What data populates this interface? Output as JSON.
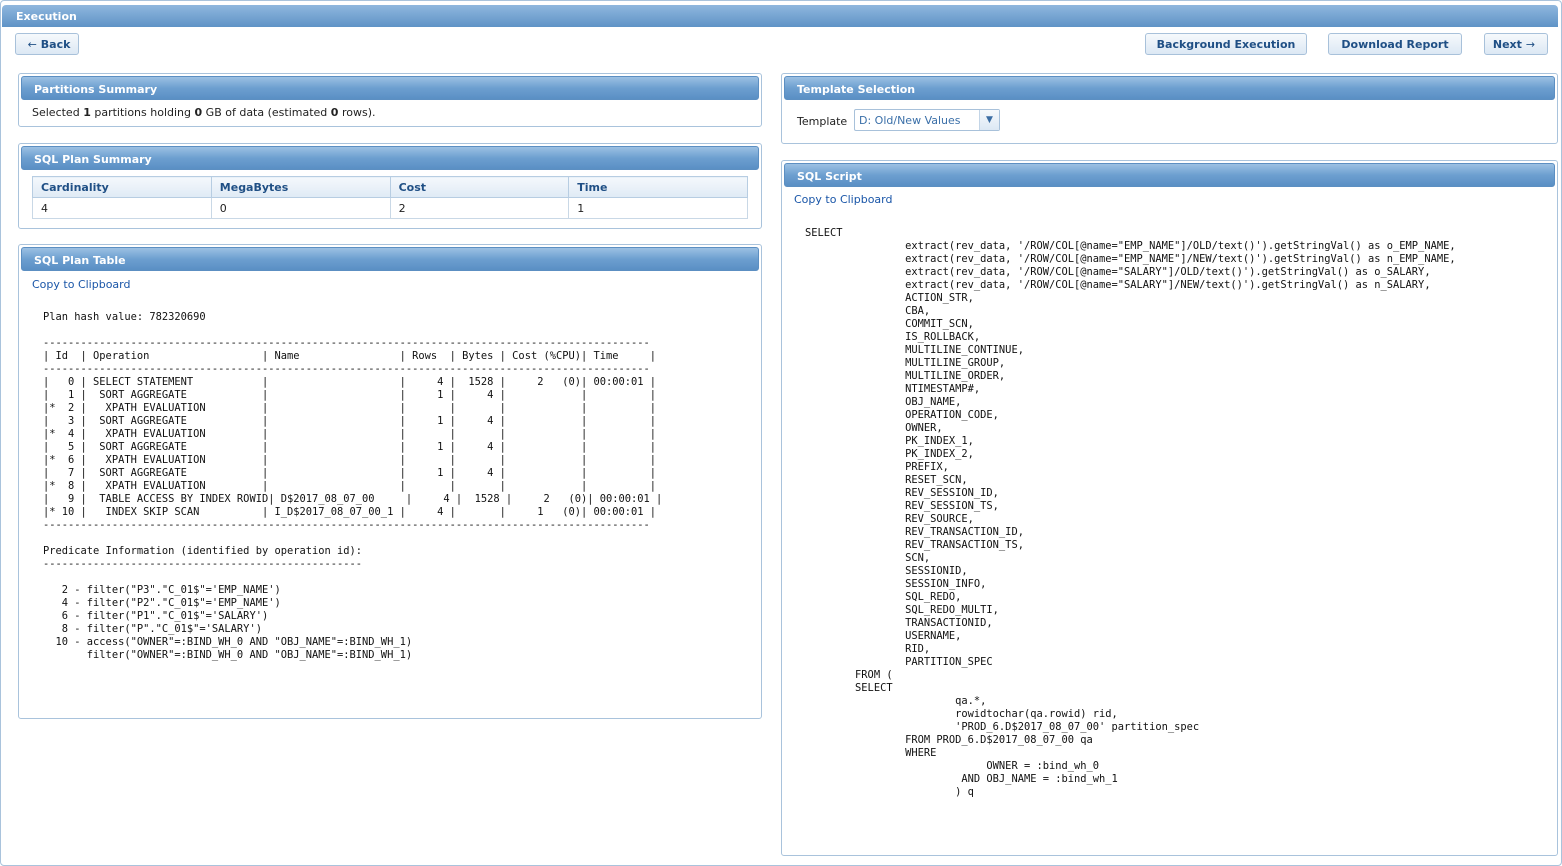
{
  "window": {
    "title": "Execution"
  },
  "toolbar": {
    "back_arrow": "←",
    "back": "Back",
    "background_execution": "Background Execution",
    "download_report": "Download Report",
    "next": "Next",
    "next_arrow": "→"
  },
  "partitions": {
    "title": "Partitions Summary",
    "text_1": "Selected ",
    "count": "1",
    "text_2": " partitions holding ",
    "gb": "0",
    "text_3": " GB of data (estimated ",
    "rows": "0",
    "text_4": " rows)."
  },
  "sql_plan_summary": {
    "title": "SQL Plan Summary",
    "columns": [
      "Cardinality",
      "MegaBytes",
      "Cost",
      "Time"
    ],
    "values": [
      "4",
      "0",
      "2",
      "1"
    ]
  },
  "sql_plan_table": {
    "title": "SQL Plan Table",
    "copy_link": "Copy to Clipboard",
    "text": "Plan hash value: 782320690\n\n-------------------------------------------------------------------------------------------------\n| Id  | Operation                  | Name                | Rows  | Bytes | Cost (%CPU)| Time     |\n-------------------------------------------------------------------------------------------------\n|   0 | SELECT STATEMENT           |                     |     4 |  1528 |     2   (0)| 00:00:01 |\n|   1 |  SORT AGGREGATE            |                     |     1 |     4 |            |          |\n|*  2 |   XPATH EVALUATION         |                     |       |       |            |          |\n|   3 |  SORT AGGREGATE            |                     |     1 |     4 |            |          |\n|*  4 |   XPATH EVALUATION         |                     |       |       |            |          |\n|   5 |  SORT AGGREGATE            |                     |     1 |     4 |            |          |\n|*  6 |   XPATH EVALUATION         |                     |       |       |            |          |\n|   7 |  SORT AGGREGATE            |                     |     1 |     4 |            |          |\n|*  8 |   XPATH EVALUATION         |                     |       |       |            |          |\n|   9 |  TABLE ACCESS BY INDEX ROWID| D$2017_08_07_00     |     4 |  1528 |     2   (0)| 00:00:01 |\n|* 10 |   INDEX SKIP SCAN          | I_D$2017_08_07_00_1 |     4 |       |     1   (0)| 00:00:01 |\n-------------------------------------------------------------------------------------------------\n\nPredicate Information (identified by operation id):\n---------------------------------------------------\n\n   2 - filter(\"P3\".\"C_01$\"='EMP_NAME')\n   4 - filter(\"P2\".\"C_01$\"='EMP_NAME')\n   6 - filter(\"P1\".\"C_01$\"='SALARY')\n   8 - filter(\"P\".\"C_01$\"='SALARY')\n  10 - access(\"OWNER\"=:BIND_WH_0 AND \"OBJ_NAME\"=:BIND_WH_1)\n       filter(\"OWNER\"=:BIND_WH_0 AND \"OBJ_NAME\"=:BIND_WH_1)"
  },
  "template_selection": {
    "title": "Template Selection",
    "label": "Template",
    "selected": "D: Old/New Values",
    "dropdown_glyph": "▼"
  },
  "sql_script": {
    "title": "SQL Script",
    "copy_link": "Copy to Clipboard",
    "text": "SELECT\n                extract(rev_data, '/ROW/COL[@name=\"EMP_NAME\"]/OLD/text()').getStringVal() as o_EMP_NAME,\n                extract(rev_data, '/ROW/COL[@name=\"EMP_NAME\"]/NEW/text()').getStringVal() as n_EMP_NAME,\n                extract(rev_data, '/ROW/COL[@name=\"SALARY\"]/OLD/text()').getStringVal() as o_SALARY,\n                extract(rev_data, '/ROW/COL[@name=\"SALARY\"]/NEW/text()').getStringVal() as n_SALARY,\n                ACTION_STR,\n                CBA,\n                COMMIT_SCN,\n                IS_ROLLBACK,\n                MULTILINE_CONTINUE,\n                MULTILINE_GROUP,\n                MULTILINE_ORDER,\n                NTIMESTAMP#,\n                OBJ_NAME,\n                OPERATION_CODE,\n                OWNER,\n                PK_INDEX_1,\n                PK_INDEX_2,\n                PREFIX,\n                RESET_SCN,\n                REV_SESSION_ID,\n                REV_SESSION_TS,\n                REV_SOURCE,\n                REV_TRANSACTION_ID,\n                REV_TRANSACTION_TS,\n                SCN,\n                SESSIONID,\n                SESSION_INFO,\n                SQL_REDO,\n                SQL_REDO_MULTI,\n                TRANSACTIONID,\n                USERNAME,\n                RID,\n                PARTITION_SPEC\n        FROM (\n        SELECT\n                        qa.*,\n                        rowidtochar(qa.rowid) rid,\n                        'PROD_6.D$2017_08_07_00' partition_spec\n                FROM PROD_6.D$2017_08_07_00 qa\n                WHERE\n                             OWNER = :bind_wh_0\n                         AND OBJ_NAME = :bind_wh_1\n                        ) q"
  }
}
